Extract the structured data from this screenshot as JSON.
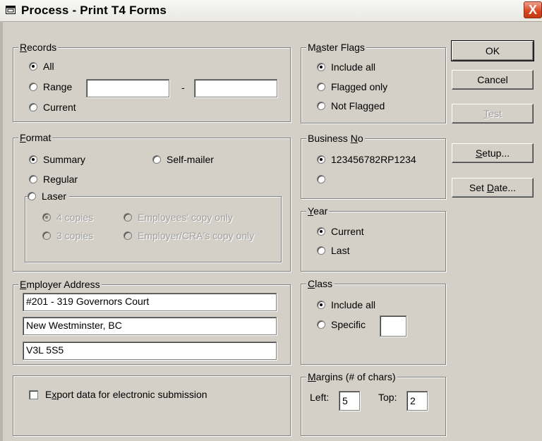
{
  "window": {
    "title": "Process - Print T4 Forms",
    "close_glyph": "X"
  },
  "records": {
    "legend_first": "R",
    "legend_rest": "ecords",
    "all": "All",
    "range": "Range",
    "range_dash": "-",
    "current": "Current",
    "range_from": "",
    "range_to": "",
    "selected": "All"
  },
  "format": {
    "legend_first": "F",
    "legend_rest": "ormat",
    "summary": "Summary",
    "self_mailer": "Self-mailer",
    "regular": "Regular",
    "laser": "Laser",
    "four_copies": "4 copies",
    "three_copies": "3 copies",
    "employees_copy": "Employees' copy only",
    "employer_cra_copy": "Employer/CRA's copy only",
    "selected": "Summary",
    "laser_selected": "4 copies"
  },
  "employer_address": {
    "legend_first": "E",
    "legend_rest": "mployer Address",
    "line1": "#201 - 319 Governors Court",
    "line2": "New Westminster, BC",
    "line3": "V3L 5S5"
  },
  "export": {
    "label_pre": "E",
    "label_ul": "x",
    "label_post": "port data for electronic submission",
    "checked": false
  },
  "master_flags": {
    "legend_pre": "M",
    "legend_ul": "a",
    "legend_post": "ster Flags",
    "include_all": "Include all",
    "flagged_only": "Flagged only",
    "not_flagged": "Not Flagged",
    "selected": "Include all"
  },
  "business_no": {
    "legend_pre": "Business ",
    "legend_ul": "N",
    "legend_post": "o",
    "option1": "123456782RP1234",
    "option2": "",
    "selected": "123456782RP1234"
  },
  "year": {
    "legend_ul": "Y",
    "legend_post": "ear",
    "current": "Current",
    "last": "Last",
    "selected": "Current"
  },
  "class": {
    "legend_ul": "C",
    "legend_post": "lass",
    "include_all": "Include all",
    "specific": "Specific",
    "specific_value": "",
    "selected": "Include all"
  },
  "margins": {
    "legend_ul": "M",
    "legend_post": "argins (# of chars)",
    "left_label": "Left:",
    "left_value": "5",
    "top_label": "Top:",
    "top_value": "2"
  },
  "buttons": {
    "ok": "OK",
    "cancel": "Cancel",
    "test_ul": "T",
    "test_post": "est",
    "setup_ul": "S",
    "setup_post": "etup...",
    "set_date_pre": "Set ",
    "set_date_ul": "D",
    "set_date_post": "ate..."
  }
}
